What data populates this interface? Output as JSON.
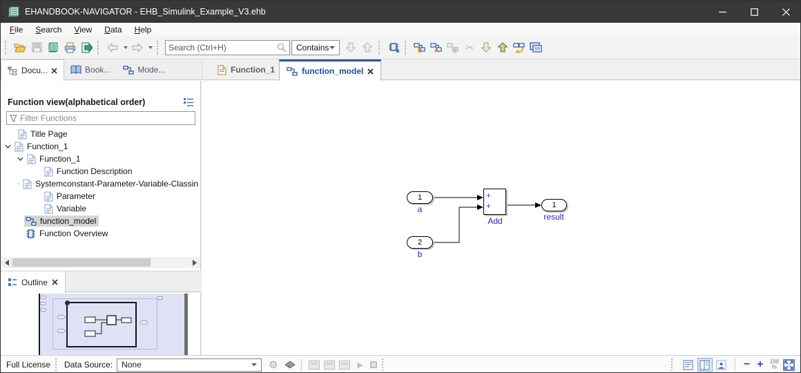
{
  "window": {
    "title": "EHANDBOOK-NAVIGATOR - EHB_Simulink_Example_V3.ehb"
  },
  "menu": {
    "items": [
      {
        "label": "File"
      },
      {
        "label": "Search"
      },
      {
        "label": "View"
      },
      {
        "label": "Data"
      },
      {
        "label": "Help"
      }
    ]
  },
  "toolbar": {
    "search_placeholder": "Search (Ctrl+H)",
    "contains_label": "Contains"
  },
  "left_panel": {
    "tabs": [
      {
        "label": "Docu..."
      },
      {
        "label": "Book..."
      },
      {
        "label": "Mode..."
      }
    ],
    "view_title": "Function view(alphabetical order)",
    "filter_placeholder": "Filter Functions",
    "tree": [
      {
        "label": "Title Page"
      },
      {
        "label": "Function_1"
      },
      {
        "label": "Function_1"
      },
      {
        "label": "Function Description"
      },
      {
        "label": "Systemconstant-Parameter-Variable-Classin"
      },
      {
        "label": "Parameter"
      },
      {
        "label": "Variable"
      },
      {
        "label": "function_model"
      },
      {
        "label": "Function Overview"
      }
    ]
  },
  "outline": {
    "tab_label": "Outline"
  },
  "main": {
    "tabs": [
      {
        "label": "Function_1"
      },
      {
        "label": "function_model"
      }
    ]
  },
  "diagram": {
    "inport_a": {
      "port": "1",
      "name": "a"
    },
    "inport_b": {
      "port": "2",
      "name": "b"
    },
    "sum": {
      "label": "Add",
      "sign_top": "+",
      "sign_bottom": "+"
    },
    "outport_result": {
      "port": "1",
      "name": "result"
    }
  },
  "statusbar": {
    "license": "Full License",
    "data_source_label": "Data Source:",
    "data_source_value": "None",
    "zoom_out": "−",
    "zoom_in": "+",
    "zoom_level_top": "100",
    "zoom_level_bottom": "%"
  },
  "icons": {
    "gear": "⚙",
    "play": "▶",
    "scissors": "✂"
  },
  "colors": {
    "accent": "#2a5699",
    "active_tab_text": "#1a4fa0",
    "diagram_label": "#2424c8",
    "selection": "#d5d5d5",
    "lavender": "#dfe2f4",
    "titlebar": "#383838"
  }
}
